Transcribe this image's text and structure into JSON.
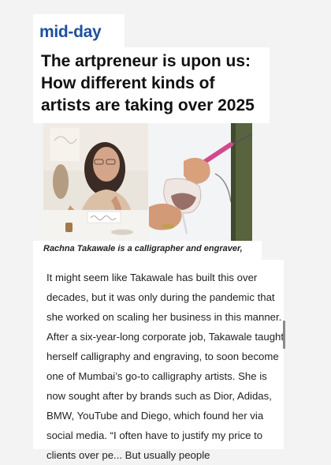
{
  "site": {
    "logo_text": "mid-day",
    "brand_color": "#1f4f9e"
  },
  "article": {
    "headline_lines": [
      "The artpreneur is upon us:",
      "How different kinds of",
      "artists are taking over 2025"
    ],
    "image_caption": "Rachna Takawale is a calligrapher and engraver,",
    "body_lines": [
      "It might seem like Takawale has built this over",
      "decades, but it was only during the pandemic that",
      "she worked on scaling her business in this manner.",
      "After a six-year-long corporate job, Takawale taught",
      "herself calligraphy and engraving, to soon become",
      "one of Mumbai’s go-to calligraphy artists. She is",
      "now sought after by brands such as Dior, Adidas,",
      "BMW, YouTube and Diego, which found her via",
      "social media.  “I often have to justify my price to",
      "clients over pe... But usually people"
    ]
  }
}
